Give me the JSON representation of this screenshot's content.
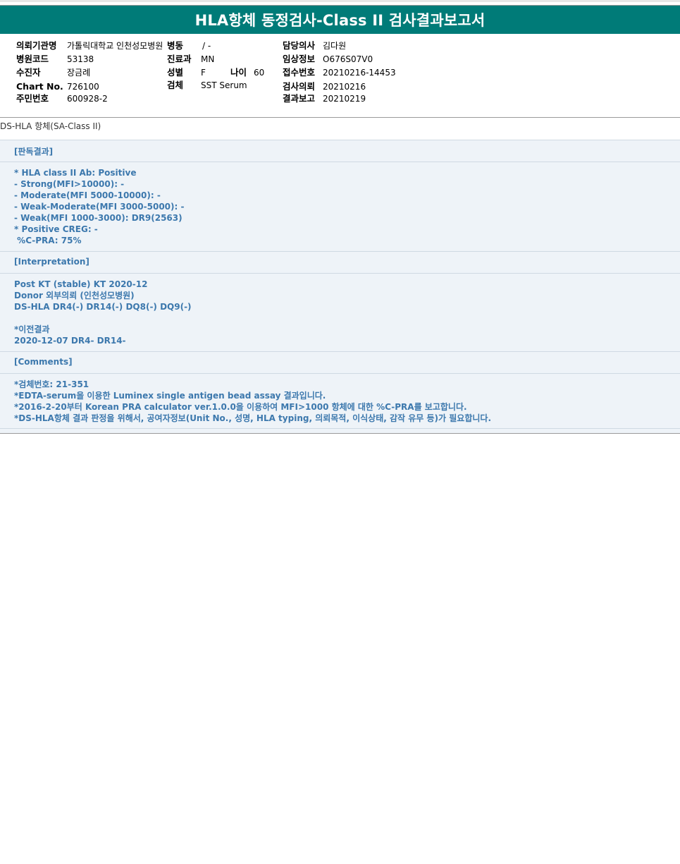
{
  "title": "HLA항체 동정검사-Class II 검사결과보고서",
  "patient_info": {
    "institution_label": "의뢰기관명",
    "institution_value": "가톨릭대학교 인천성모병원",
    "ward_label": "병동",
    "ward_value": "/ -",
    "doctor_label": "담당의사",
    "doctor_value": "김다원",
    "hospital_code_label": "병원코드",
    "hospital_code_value": "53138",
    "dept_label": "진료과",
    "dept_value": "MN",
    "clinical_label": "임상정보",
    "clinical_value": "O676S07V0",
    "recipient_label": "수진자",
    "recipient_value": "장금례",
    "sex_label": "성별",
    "sex_value": "F",
    "age_label": "나이",
    "age_value": "60",
    "accession_label": "접수번호",
    "accession_value": "20210216-14453",
    "chart_label": "Chart No.",
    "chart_value": "726100",
    "specimen_label": "검체",
    "specimen_value": "SST Serum",
    "request_label": "검사의뢰",
    "request_value": "20210216",
    "resident_label": "주민번호",
    "resident_value": "600928-2",
    "report_label": "결과보고",
    "report_value": "20210219"
  },
  "section_caption": "DS-HLA 항체(SA-Class II)",
  "result_header": "[판독결과]",
  "result_lines": [
    "* HLA class II Ab: Positive",
    "- Strong(MFI>10000): -",
    "- Moderate(MFI 5000-10000): -",
    "- Weak-Moderate(MFI 3000-5000): -",
    "- Weak(MFI 1000-3000): DR9(2563)",
    "* Positive CREG: -",
    " %C-PRA: 75%"
  ],
  "interpretation_header": "[Interpretation]",
  "interpretation_lines": [
    "Post KT (stable) KT 2020-12",
    "Donor 외부의뢰 (인천성모병원)",
    "DS-HLA DR4(-) DR14(-) DQ8(-) DQ9(-)",
    "",
    "*이전결과",
    "2020-12-07 DR4- DR14-"
  ],
  "comments_header": "[Comments]",
  "comment_lines": [
    "*검체번호: 21-351",
    "*EDTA-serum을 이용한 Luminex single antigen bead assay 결과입니다.",
    "*2016-2-20부터 Korean PRA calculator ver.1.0.0을 이용하여 MFI>1000 항체에 대한 %C-PRA를 보고합니다.",
    "*DS-HLA항체 결과 판정을 위해서, 공여자정보(Unit No., 성명, HLA typing, 의뢰목적, 이식상태, 감작 유무 등)가 필요합니다."
  ],
  "colors": {
    "title_bar": "#007b78",
    "report_text": "#3c78ad",
    "report_bg": "#eef3f8"
  }
}
